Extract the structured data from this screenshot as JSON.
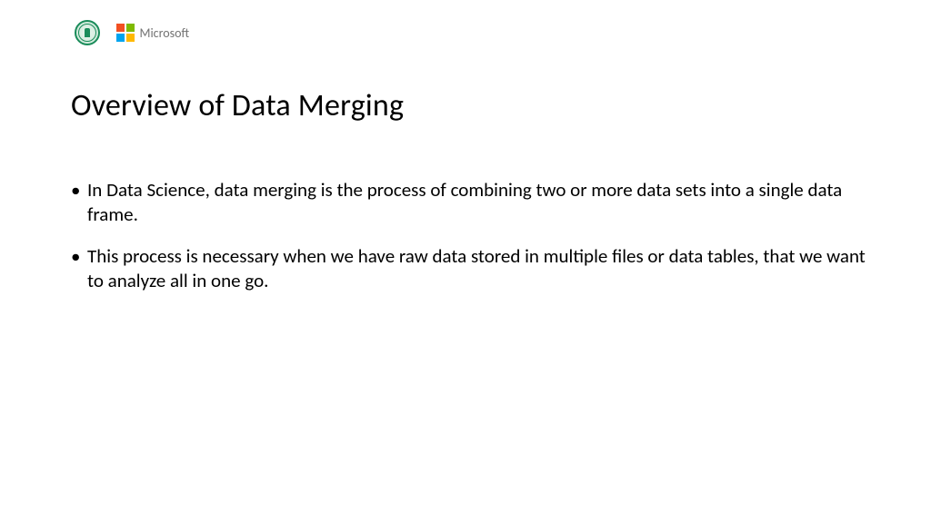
{
  "header": {
    "ms_label": "Microsoft"
  },
  "slide": {
    "title": "Overview of Data Merging",
    "bullets": [
      "In Data Science, data merging is the process of combining two or more data sets into a single data frame.",
      "This process is necessary when we have raw data stored in multiple files or data tables, that we want to analyze all in one go."
    ]
  }
}
